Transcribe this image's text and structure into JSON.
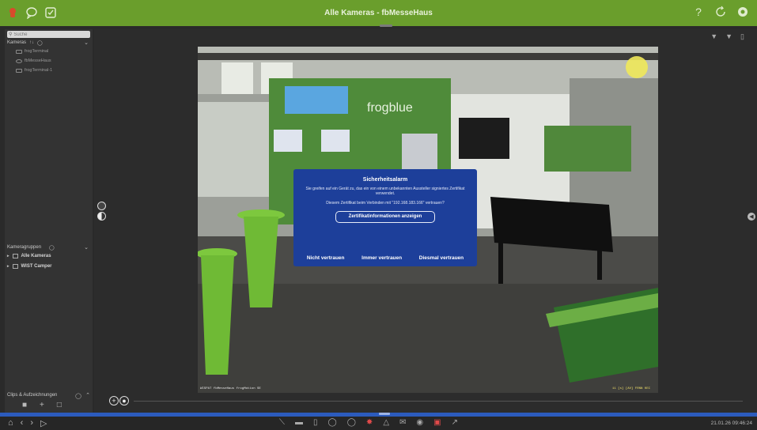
{
  "window": {
    "title": "Alle Kameras - fbMesseHaus"
  },
  "sidebar": {
    "search_placeholder": "Suche",
    "cameras_header": "Kameras",
    "cameras_sort": "↑↓",
    "cameras": [
      {
        "label": "frogTerminal"
      },
      {
        "label": "fbMesseHaus"
      },
      {
        "label": "frogTerminal-1"
      }
    ],
    "groups_header": "Kameragruppen",
    "groups": [
      {
        "label": "Alle Kameras"
      },
      {
        "label": "WIST Camper"
      }
    ],
    "clips_header": "Clips & Aufzeichnungen"
  },
  "camera": {
    "overlay_left": "WISPAT fbMesseHaus frogMotion SE",
    "overlay_right": "11 [s] [AV] FRNN 0EC",
    "frog_brand": "frogblue"
  },
  "dialog": {
    "title": "Sicherheitsalarm",
    "message": "Sie greifen auf ein Gerät zu, das ein von einem unbekannten Aussteller signiertes Zertifikat verwendet.",
    "question": "Diesem Zertifikat beim Verbinden mit \"192.168.183.166\" vertrauen?",
    "info_button": "Zertifikatinformationen anzeigen",
    "actions": [
      "Nicht vertrauen",
      "Immer vertrauen",
      "Diesmal vertrauen"
    ]
  },
  "statusbar": {
    "datetime": "21.01.26 09:46:24"
  },
  "colors": {
    "titlebar": "#6a9e2c",
    "dialog": "#1d3f9a",
    "accent_strip": "#2c5bbd"
  },
  "icons": {
    "titlebar_left": [
      "frog-logo-icon",
      "chat-icon",
      "checkbox-icon"
    ],
    "titlebar_right": [
      "help-icon",
      "refresh-icon",
      "settings-icon"
    ],
    "bottom_left": [
      "home-icon",
      "back-icon",
      "forward-icon",
      "play-icon"
    ],
    "bottom_center": [
      "ptz-icon",
      "bar-icon",
      "door-icon",
      "microphone-icon",
      "mic-alt-icon",
      "light-icon",
      "bell-icon",
      "mail-icon",
      "snapshot-icon",
      "record-icon",
      "export-icon"
    ]
  }
}
